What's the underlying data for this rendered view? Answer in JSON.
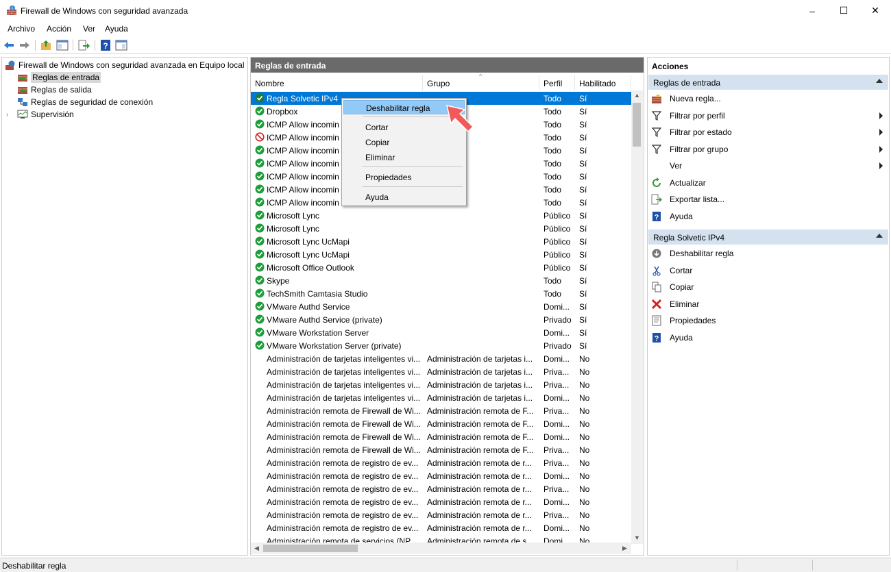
{
  "window": {
    "title": "Firewall de Windows con seguridad avanzada",
    "minimize": "–",
    "maximize": "☐",
    "close": "✕"
  },
  "menu": [
    "Archivo",
    "Acción",
    "Ver",
    "Ayuda"
  ],
  "toolbar": {
    "icons": [
      "back-arrow-icon",
      "forward-arrow-icon",
      "up-folder-icon",
      "show-hide-tree-icon",
      "export-list-icon",
      "help-icon",
      "action-pane-icon"
    ]
  },
  "tree": {
    "root": "Firewall de Windows con seguridad avanzada en Equipo local",
    "items": [
      "Reglas de entrada",
      "Reglas de salida",
      "Reglas de seguridad de conexión",
      "Supervisión"
    ],
    "selected": "Reglas de entrada"
  },
  "center": {
    "header": "Reglas de entrada",
    "columns": [
      "Nombre",
      "Grupo",
      "Perfil",
      "Habilitado"
    ],
    "rows": [
      {
        "name": "Regla Solvetic IPv4",
        "group": "",
        "profile": "Todo",
        "enabled": "Sí",
        "status": "enabled-sel"
      },
      {
        "name": "Dropbox",
        "group": "",
        "profile": "Todo",
        "enabled": "Sí",
        "status": "enabled"
      },
      {
        "name": "ICMP Allow incomin",
        "group": "",
        "profile": "Todo",
        "enabled": "Sí",
        "status": "enabled"
      },
      {
        "name": "ICMP Allow incomin",
        "group": "",
        "profile": "Todo",
        "enabled": "Sí",
        "status": "blocked"
      },
      {
        "name": "ICMP Allow incomin",
        "group": "",
        "profile": "Todo",
        "enabled": "Sí",
        "status": "enabled"
      },
      {
        "name": "ICMP Allow incomin",
        "group": "",
        "profile": "Todo",
        "enabled": "Sí",
        "status": "enabled"
      },
      {
        "name": "ICMP Allow incomin",
        "group": "",
        "profile": "Todo",
        "enabled": "Sí",
        "status": "enabled"
      },
      {
        "name": "ICMP Allow incomin",
        "group": "",
        "profile": "Todo",
        "enabled": "Sí",
        "status": "enabled"
      },
      {
        "name": "ICMP Allow incomin",
        "group": "",
        "profile": "Todo",
        "enabled": "Sí",
        "status": "enabled"
      },
      {
        "name": "Microsoft Lync",
        "group": "",
        "profile": "Público",
        "enabled": "Sí",
        "status": "enabled"
      },
      {
        "name": "Microsoft Lync",
        "group": "",
        "profile": "Público",
        "enabled": "Sí",
        "status": "enabled"
      },
      {
        "name": "Microsoft Lync UcMapi",
        "group": "",
        "profile": "Público",
        "enabled": "Sí",
        "status": "enabled"
      },
      {
        "name": "Microsoft Lync UcMapi",
        "group": "",
        "profile": "Público",
        "enabled": "Sí",
        "status": "enabled"
      },
      {
        "name": "Microsoft Office Outlook",
        "group": "",
        "profile": "Público",
        "enabled": "Sí",
        "status": "enabled"
      },
      {
        "name": "Skype",
        "group": "",
        "profile": "Todo",
        "enabled": "Sí",
        "status": "enabled"
      },
      {
        "name": "TechSmith Camtasia Studio",
        "group": "",
        "profile": "Todo",
        "enabled": "Sí",
        "status": "enabled"
      },
      {
        "name": "VMware Authd Service",
        "group": "",
        "profile": "Domi...",
        "enabled": "Sí",
        "status": "enabled"
      },
      {
        "name": "VMware Authd Service (private)",
        "group": "",
        "profile": "Privado",
        "enabled": "Sí",
        "status": "enabled"
      },
      {
        "name": "VMware Workstation Server",
        "group": "",
        "profile": "Domi...",
        "enabled": "Sí",
        "status": "enabled"
      },
      {
        "name": "VMware Workstation Server (private)",
        "group": "",
        "profile": "Privado",
        "enabled": "Sí",
        "status": "enabled"
      },
      {
        "name": "Administración de tarjetas inteligentes vi...",
        "group": "Administración de tarjetas i...",
        "profile": "Domi...",
        "enabled": "No",
        "status": "none"
      },
      {
        "name": "Administración de tarjetas inteligentes vi...",
        "group": "Administración de tarjetas i...",
        "profile": "Priva...",
        "enabled": "No",
        "status": "none"
      },
      {
        "name": "Administración de tarjetas inteligentes vi...",
        "group": "Administración de tarjetas i...",
        "profile": "Priva...",
        "enabled": "No",
        "status": "none"
      },
      {
        "name": "Administración de tarjetas inteligentes vi...",
        "group": "Administración de tarjetas i...",
        "profile": "Domi...",
        "enabled": "No",
        "status": "none"
      },
      {
        "name": "Administración remota de Firewall de Wi...",
        "group": "Administración remota de F...",
        "profile": "Priva...",
        "enabled": "No",
        "status": "none"
      },
      {
        "name": "Administración remota de Firewall de Wi...",
        "group": "Administración remota de F...",
        "profile": "Domi...",
        "enabled": "No",
        "status": "none"
      },
      {
        "name": "Administración remota de Firewall de Wi...",
        "group": "Administración remota de F...",
        "profile": "Domi...",
        "enabled": "No",
        "status": "none"
      },
      {
        "name": "Administración remota de Firewall de Wi...",
        "group": "Administración remota de F...",
        "profile": "Priva...",
        "enabled": "No",
        "status": "none"
      },
      {
        "name": "Administración remota de registro de ev...",
        "group": "Administración remota de r...",
        "profile": "Priva...",
        "enabled": "No",
        "status": "none"
      },
      {
        "name": "Administración remota de registro de ev...",
        "group": "Administración remota de r...",
        "profile": "Domi...",
        "enabled": "No",
        "status": "none"
      },
      {
        "name": "Administración remota de registro de ev...",
        "group": "Administración remota de r...",
        "profile": "Priva...",
        "enabled": "No",
        "status": "none"
      },
      {
        "name": "Administración remota de registro de ev...",
        "group": "Administración remota de r...",
        "profile": "Domi...",
        "enabled": "No",
        "status": "none"
      },
      {
        "name": "Administración remota de registro de ev...",
        "group": "Administración remota de r...",
        "profile": "Priva...",
        "enabled": "No",
        "status": "none"
      },
      {
        "name": "Administración remota de registro de ev...",
        "group": "Administración remota de r...",
        "profile": "Domi...",
        "enabled": "No",
        "status": "none"
      },
      {
        "name": "Administración remota de servicios (NP ...",
        "group": "Administración remota de s...",
        "profile": "Domi...",
        "enabled": "No",
        "status": "none"
      }
    ]
  },
  "context_menu": {
    "items": [
      "Deshabilitar regla",
      "Cortar",
      "Copiar",
      "Eliminar",
      "Propiedades",
      "Ayuda"
    ],
    "highlighted": "Deshabilitar regla"
  },
  "actions": {
    "title": "Acciones",
    "section1": {
      "header": "Reglas de entrada",
      "items": [
        {
          "label": "Nueva regla...",
          "icon": "new-rule-icon",
          "submenu": false
        },
        {
          "label": "Filtrar por perfil",
          "icon": "filter-icon",
          "submenu": true
        },
        {
          "label": "Filtrar por estado",
          "icon": "filter-icon",
          "submenu": true
        },
        {
          "label": "Filtrar por grupo",
          "icon": "filter-icon",
          "submenu": true
        },
        {
          "label": "Ver",
          "icon": "",
          "submenu": true
        },
        {
          "label": "Actualizar",
          "icon": "refresh-icon",
          "submenu": false
        },
        {
          "label": "Exportar lista...",
          "icon": "export-icon",
          "submenu": false
        },
        {
          "label": "Ayuda",
          "icon": "help-icon",
          "submenu": false
        }
      ]
    },
    "section2": {
      "header": "Regla Solvetic IPv4",
      "items": [
        {
          "label": "Deshabilitar regla",
          "icon": "disable-rule-icon"
        },
        {
          "label": "Cortar",
          "icon": "cut-icon"
        },
        {
          "label": "Copiar",
          "icon": "copy-icon"
        },
        {
          "label": "Eliminar",
          "icon": "delete-icon"
        },
        {
          "label": "Propiedades",
          "icon": "properties-icon"
        },
        {
          "label": "Ayuda",
          "icon": "help-icon"
        }
      ]
    }
  },
  "statusbar": {
    "text": "Deshabilitar regla"
  },
  "colors": {
    "selection": "#0078d7",
    "header_dark": "#6a6a6a",
    "action_section": "#d4e1ee",
    "enabled_green": "#1e9e3a",
    "menu_highlight": "#91c9f7",
    "annotation_arrow": "#f05a5a"
  }
}
